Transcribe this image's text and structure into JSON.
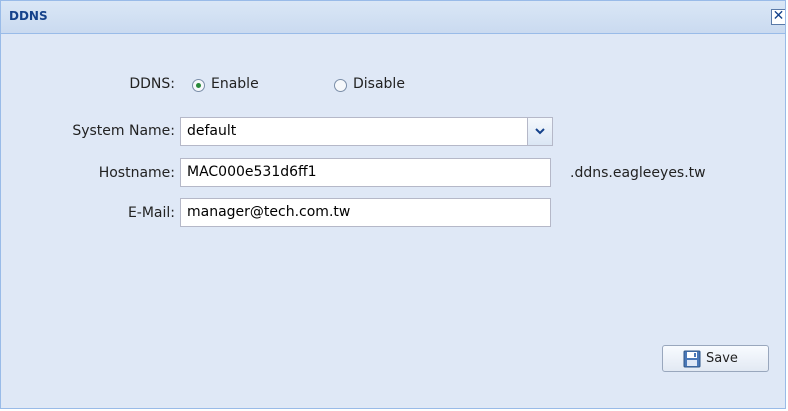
{
  "dialog": {
    "title": "DDNS",
    "close_glyph": "✕"
  },
  "form": {
    "ddns_label": "DDNS:",
    "enable_label": "Enable",
    "disable_label": "Disable",
    "ddns_selected": "Enable",
    "system_name_label": "System Name:",
    "system_name_value": "default",
    "hostname_label": "Hostname:",
    "hostname_value": "MAC000e531d6ff1",
    "hostname_suffix": ".ddns.eagleeyes.tw",
    "email_label": "E-Mail:",
    "email_value": "manager@tech.com.tw"
  },
  "actions": {
    "save_label": "Save"
  },
  "icons": {
    "close": "close-icon",
    "dropdown": "chevron-down-icon",
    "save": "floppy-disk-icon"
  },
  "colors": {
    "title_text": "#15428b",
    "panel_bg": "#dfe8f6",
    "border": "#99bbe8"
  }
}
